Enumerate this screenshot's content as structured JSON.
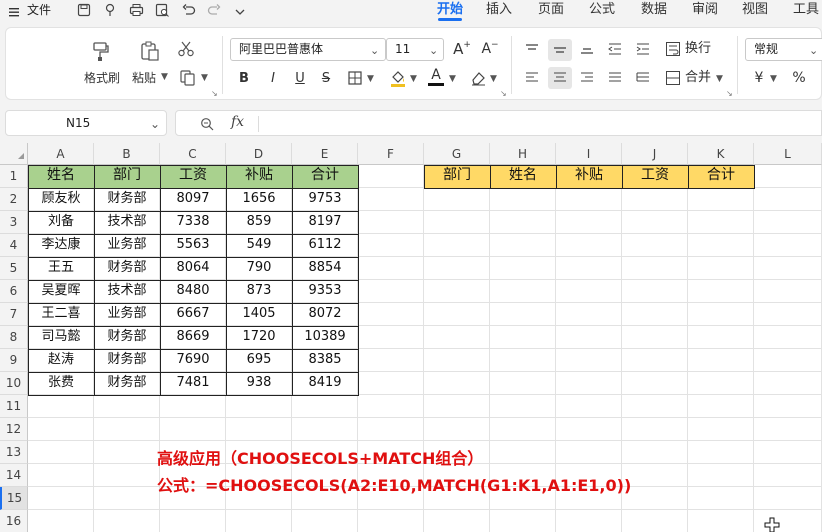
{
  "menubar": {
    "file": "文件",
    "tabs": [
      "开始",
      "插入",
      "页面",
      "公式",
      "数据",
      "审阅",
      "视图",
      "工具"
    ],
    "active_tab": "开始"
  },
  "ribbon": {
    "format_painter": "格式刷",
    "paste": "粘贴",
    "font_name": "阿里巴巴普惠体",
    "font_size": "11",
    "bold": "B",
    "italic": "I",
    "underline": "U",
    "font_color_letter": "A",
    "wrap": "换行",
    "merge": "合并",
    "number_format": "常规",
    "currency_symbol": "¥",
    "percent_symbol": "%"
  },
  "formula_bar": {
    "name_box": "N15",
    "fx_label": "fx",
    "formula": ""
  },
  "columns": [
    "A",
    "B",
    "C",
    "D",
    "E",
    "F",
    "G",
    "H",
    "I",
    "J",
    "K",
    "L"
  ],
  "rows": [
    "1",
    "2",
    "3",
    "4",
    "5",
    "6",
    "7",
    "8",
    "9",
    "10",
    "11",
    "12",
    "13",
    "14",
    "15",
    "16"
  ],
  "source_table": {
    "headers": [
      "姓名",
      "部门",
      "工资",
      "补贴",
      "合计"
    ],
    "rows": [
      [
        "顾友秋",
        "财务部",
        "8097",
        "1656",
        "9753"
      ],
      [
        "刘备",
        "技术部",
        "7338",
        "859",
        "8197"
      ],
      [
        "李达康",
        "业务部",
        "5563",
        "549",
        "6112"
      ],
      [
        "王五",
        "财务部",
        "8064",
        "790",
        "8854"
      ],
      [
        "吴夏晖",
        "技术部",
        "8480",
        "873",
        "9353"
      ],
      [
        "王二喜",
        "业务部",
        "6667",
        "1405",
        "8072"
      ],
      [
        "司马懿",
        "财务部",
        "8669",
        "1720",
        "10389"
      ],
      [
        "赵涛",
        "财务部",
        "7690",
        "695",
        "8385"
      ],
      [
        "张费",
        "财务部",
        "7481",
        "938",
        "8419"
      ]
    ]
  },
  "target_headers": [
    "部门",
    "姓名",
    "补贴",
    "工资",
    "合计"
  ],
  "notes": {
    "line1": "高级应用（CHOOSECOLS+MATCH组合）",
    "line2": "公式：=CHOOSECOLS(A2:E10,MATCH(G1:K1,A1:E1,0))"
  },
  "colors": {
    "accent": "#1a6ff0",
    "header_green": "#a9d18e",
    "header_yellow": "#ffd966",
    "note_red": "#e01010"
  }
}
